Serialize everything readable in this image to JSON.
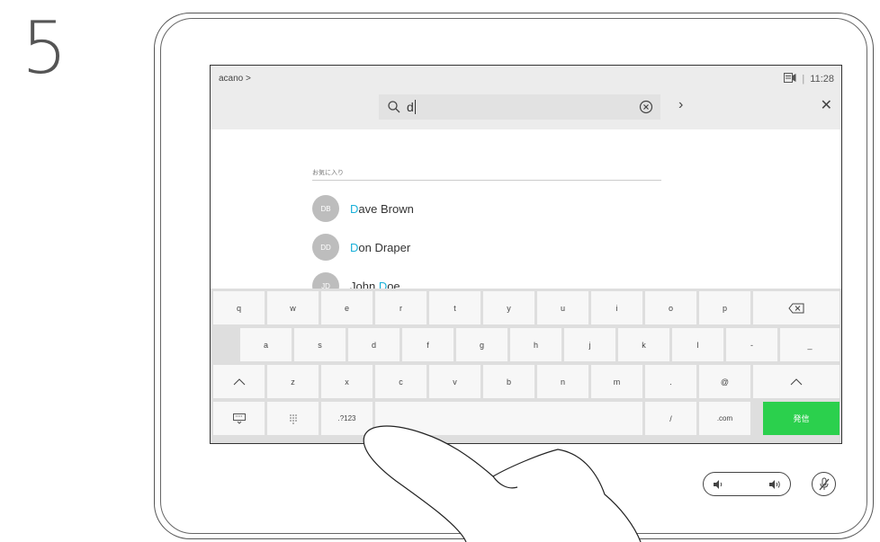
{
  "step_number": "5",
  "screen": {
    "breadcrumb": "acano >",
    "time": "11:28",
    "search": {
      "value": "d"
    },
    "favorites_label": "お気に入り",
    "contacts": [
      {
        "initials": "DB",
        "match": "D",
        "rest": "ave Brown"
      },
      {
        "initials": "DD",
        "match": "D",
        "rest": "on Draper"
      },
      {
        "initials": "JD",
        "prefix": "John ",
        "match": "D",
        "rest": "oe"
      }
    ]
  },
  "keyboard": {
    "row1": [
      "q",
      "w",
      "e",
      "r",
      "t",
      "y",
      "u",
      "i",
      "o",
      "p"
    ],
    "row2": [
      "a",
      "s",
      "d",
      "f",
      "g",
      "h",
      "j",
      "k",
      "l",
      "-",
      "_"
    ],
    "row3": [
      "z",
      "x",
      "c",
      "v",
      "b",
      "n",
      "m",
      ".",
      "@"
    ],
    "row4": {
      "numbers": ".?123",
      "slash": "/",
      "com": ".com",
      "send": "発信"
    }
  },
  "colors": {
    "send_key": "#2bd04d",
    "match_highlight": "#19b0d9"
  },
  "icons": [
    "search-icon",
    "clear-icon",
    "chevron-right-icon",
    "close-icon",
    "backspace-icon",
    "shift-icon",
    "keyboard-hide-icon",
    "dots-icon",
    "volume-down-icon",
    "volume-up-icon",
    "mic-mute-icon",
    "camera-icon"
  ]
}
